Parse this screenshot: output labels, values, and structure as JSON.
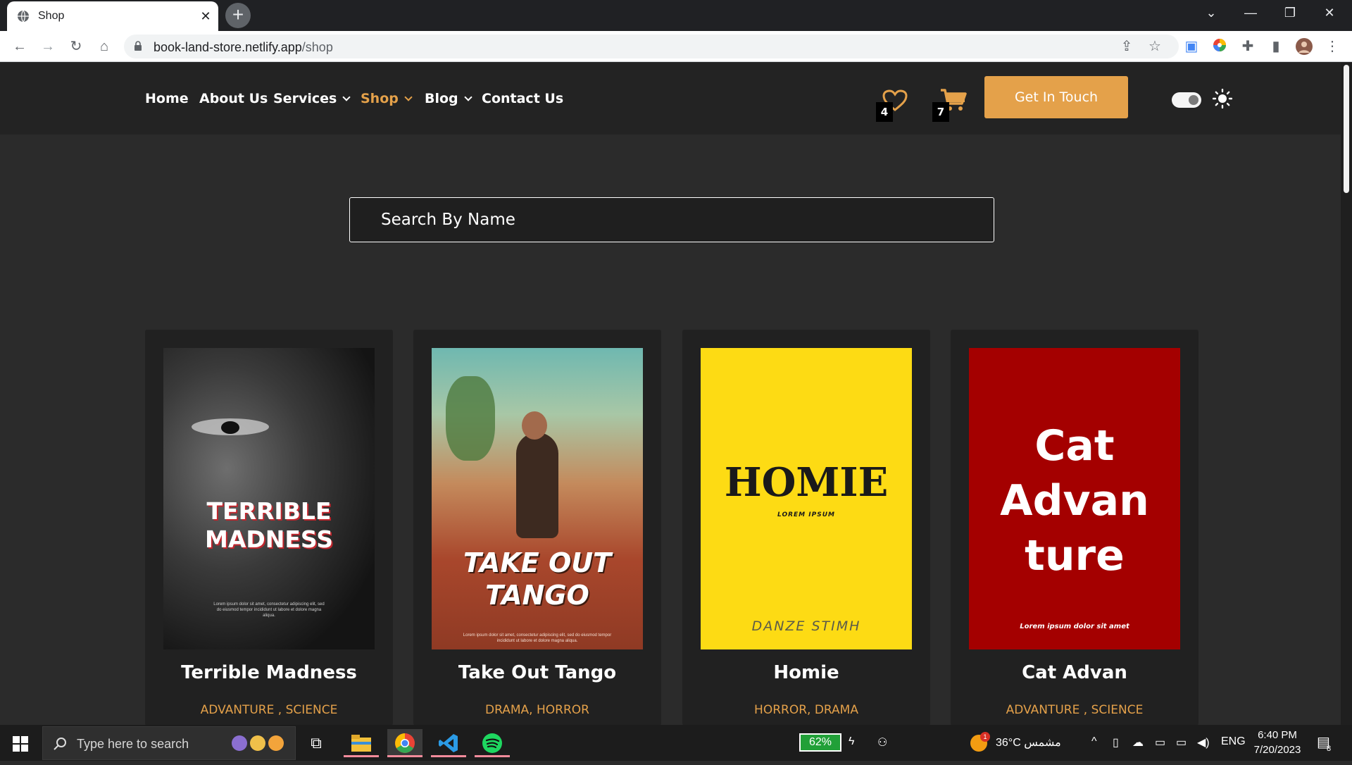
{
  "browser": {
    "tab_title": "Shop",
    "url_host": "book-land-store.netlify.app",
    "url_path": "/shop"
  },
  "nav": {
    "items": [
      {
        "label": "Home"
      },
      {
        "label": "About Us"
      },
      {
        "label": "Services"
      },
      {
        "label": "Shop"
      },
      {
        "label": "Blog"
      },
      {
        "label": "Contact Us"
      }
    ],
    "wishlist_count": "4",
    "cart_count": "7",
    "cta_label": "Get In Touch"
  },
  "search": {
    "placeholder": "Search By Name"
  },
  "products": [
    {
      "title": "Terrible Madness",
      "genres": "ADVANTURE , SCIENCE",
      "cover_line1": "TERRIBLE",
      "cover_line2": "MADNESS",
      "cover_small": "Lorem ipsum dolor sit amet, consectetur adipiscing elit, sed do eiusmod tempor incididunt ut labore et dolore magna aliqua."
    },
    {
      "title": "Take Out Tango",
      "genres": "DRAMA, HORROR",
      "cover_line1": "TAKE OUT",
      "cover_line2": "TANGO",
      "cover_small": "Lorem ipsum dolor sit amet, consectetur adipiscing elit, sed do eiusmod tempor incididunt ut labore et dolore magna aliqua."
    },
    {
      "title": "Homie",
      "genres": "HORROR, DRAMA",
      "cover_line1": "HOMIE",
      "cover_small": "LOREM IPSUM",
      "cover_author": "DANZE STIMH"
    },
    {
      "title": "Cat Advan",
      "genres": "ADVANTURE , SCIENCE",
      "cover_line1": "Cat",
      "cover_line2": "Advan",
      "cover_line3": "ture",
      "cover_small": "Lorem ipsum dolor sit amet"
    }
  ],
  "taskbar": {
    "search_placeholder": "Type here to search",
    "battery": "62%",
    "weather": "36°C مشمس",
    "lang": "ENG",
    "time": "6:40 PM",
    "date": "7/20/2023",
    "notifications": "8",
    "weather_badge": "1"
  },
  "colors": {
    "accent": "#e4a14a",
    "header_bg": "#232323",
    "page_bg": "#2b2b2b",
    "card_bg": "#212121"
  }
}
